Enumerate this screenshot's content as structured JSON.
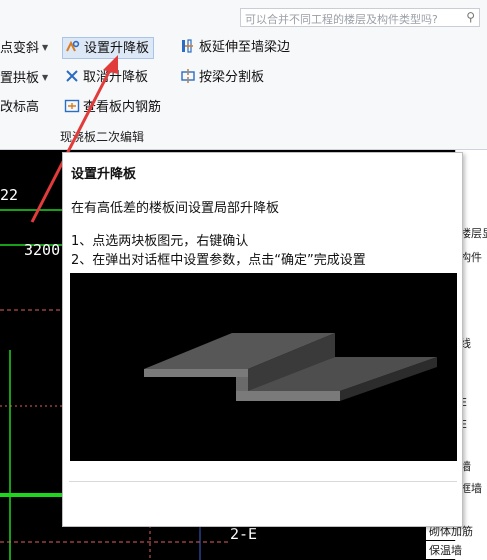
{
  "ribbon": {
    "search_placeholder": "可以合并不同工程的楼层及构件类型吗?",
    "left_col": [
      "点变斜",
      "置拱板",
      "改标高"
    ],
    "mid_col": [
      "设置升降板",
      "取消升降板",
      "查看板内钢筋"
    ],
    "right_col": [
      "板延伸至墙梁边",
      "按梁分割板"
    ],
    "group_label": "现浇板二次编辑"
  },
  "tooltip": {
    "title": "设置升降板",
    "description": "在有高低差的楼板间设置局部升降板",
    "step1": "1、点选两块板图元，右键确认",
    "step2": "2、在弹出对话框中设置参数，点击“确定”完成设置"
  },
  "canvas": {
    "label_22": "22",
    "label_3200": "3200",
    "label_2e": "2-E"
  },
  "right_panel": {
    "items": [
      "楼层显",
      "构件",
      "线",
      "E",
      "E",
      "墙",
      "框墙",
      "砌体加筋",
      "保温墙"
    ]
  },
  "colors": {
    "accent_green": "#1fd61f",
    "arrow_red": "#e23b3b",
    "cad_bg": "#000000"
  }
}
